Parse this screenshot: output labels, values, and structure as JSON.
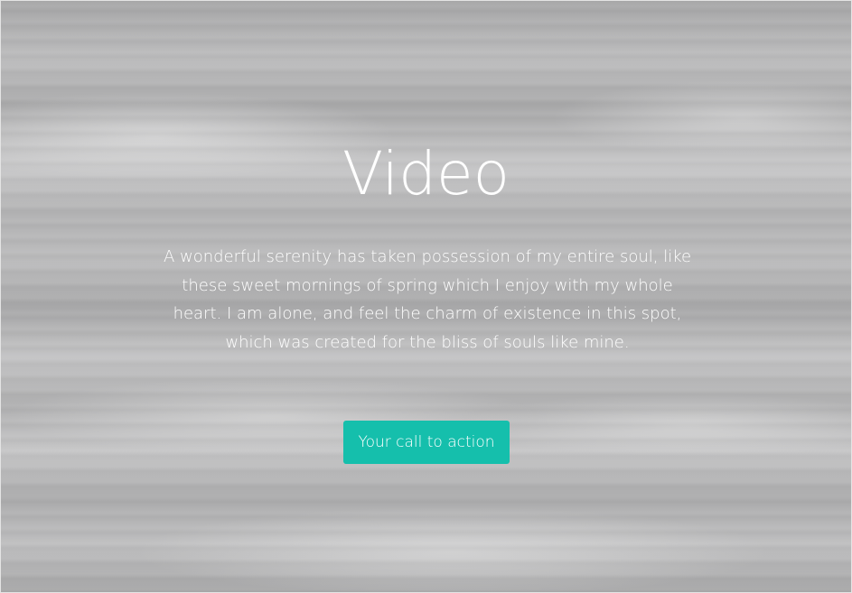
{
  "hero": {
    "title": "Video",
    "description": "A wonderful serenity has taken possession of my entire soul, like these sweet mornings of spring which I enjoy with my whole heart. I am alone, and feel the charm of existence in this spot, which was created for the bliss of souls like mine.",
    "cta_label": "Your call to action"
  },
  "colors": {
    "accent": "#15bfac",
    "text": "#ffffff"
  }
}
